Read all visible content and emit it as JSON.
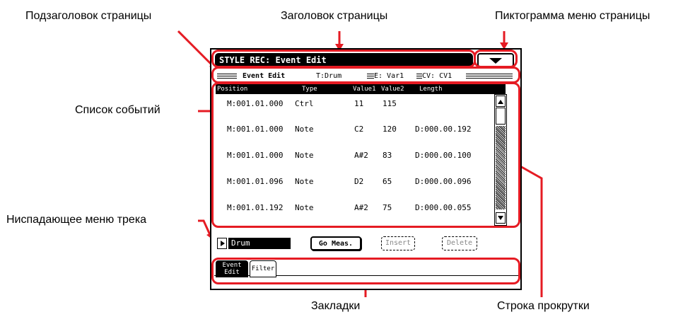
{
  "callouts": {
    "subtitle": "Подзаголовок страницы",
    "title": "Заголовок страницы",
    "menu_icon": "Пиктограмма меню страницы",
    "event_list": "Список событий",
    "track_menu": "Ниспадающее меню трека",
    "tabs": "Закладки",
    "scrollbar": "Строка прокрутки"
  },
  "screen": {
    "title": "STYLE REC: Event Edit",
    "subtitle": {
      "page": "Event Edit",
      "track": "T:Drum",
      "element": "E: Var1",
      "cv": "CV: CV1"
    },
    "list": {
      "columns": [
        "Position",
        "Type",
        "Value1",
        "Value2",
        "Length"
      ],
      "rows": [
        {
          "position": "M:001.01.000",
          "type": "Ctrl",
          "value1": "11",
          "value2": "115",
          "length": ""
        },
        {
          "position": "M:001.01.000",
          "type": "Note",
          "value1": "C2",
          "value2": "120",
          "length": "D:000.00.192"
        },
        {
          "position": "M:001.01.000",
          "type": "Note",
          "value1": "A#2",
          "value2": "83",
          "length": "D:000.00.100"
        },
        {
          "position": "M:001.01.096",
          "type": "Note",
          "value1": "D2",
          "value2": "65",
          "length": "D:000.00.096"
        },
        {
          "position": "M:001.01.192",
          "type": "Note",
          "value1": "A#2",
          "value2": "75",
          "length": "D:000.00.055"
        }
      ]
    },
    "track_value": "Drum",
    "buttons": {
      "go_meas": "Go Meas.",
      "insert": "Insert",
      "delete": "Delete"
    },
    "tabs": [
      {
        "label_line1": "Event",
        "label_line2": "Edit",
        "active": true
      },
      {
        "label": "Filter",
        "active": false
      }
    ]
  },
  "colors": {
    "highlight": "#e51b23",
    "lcd_ink": "#000000"
  }
}
